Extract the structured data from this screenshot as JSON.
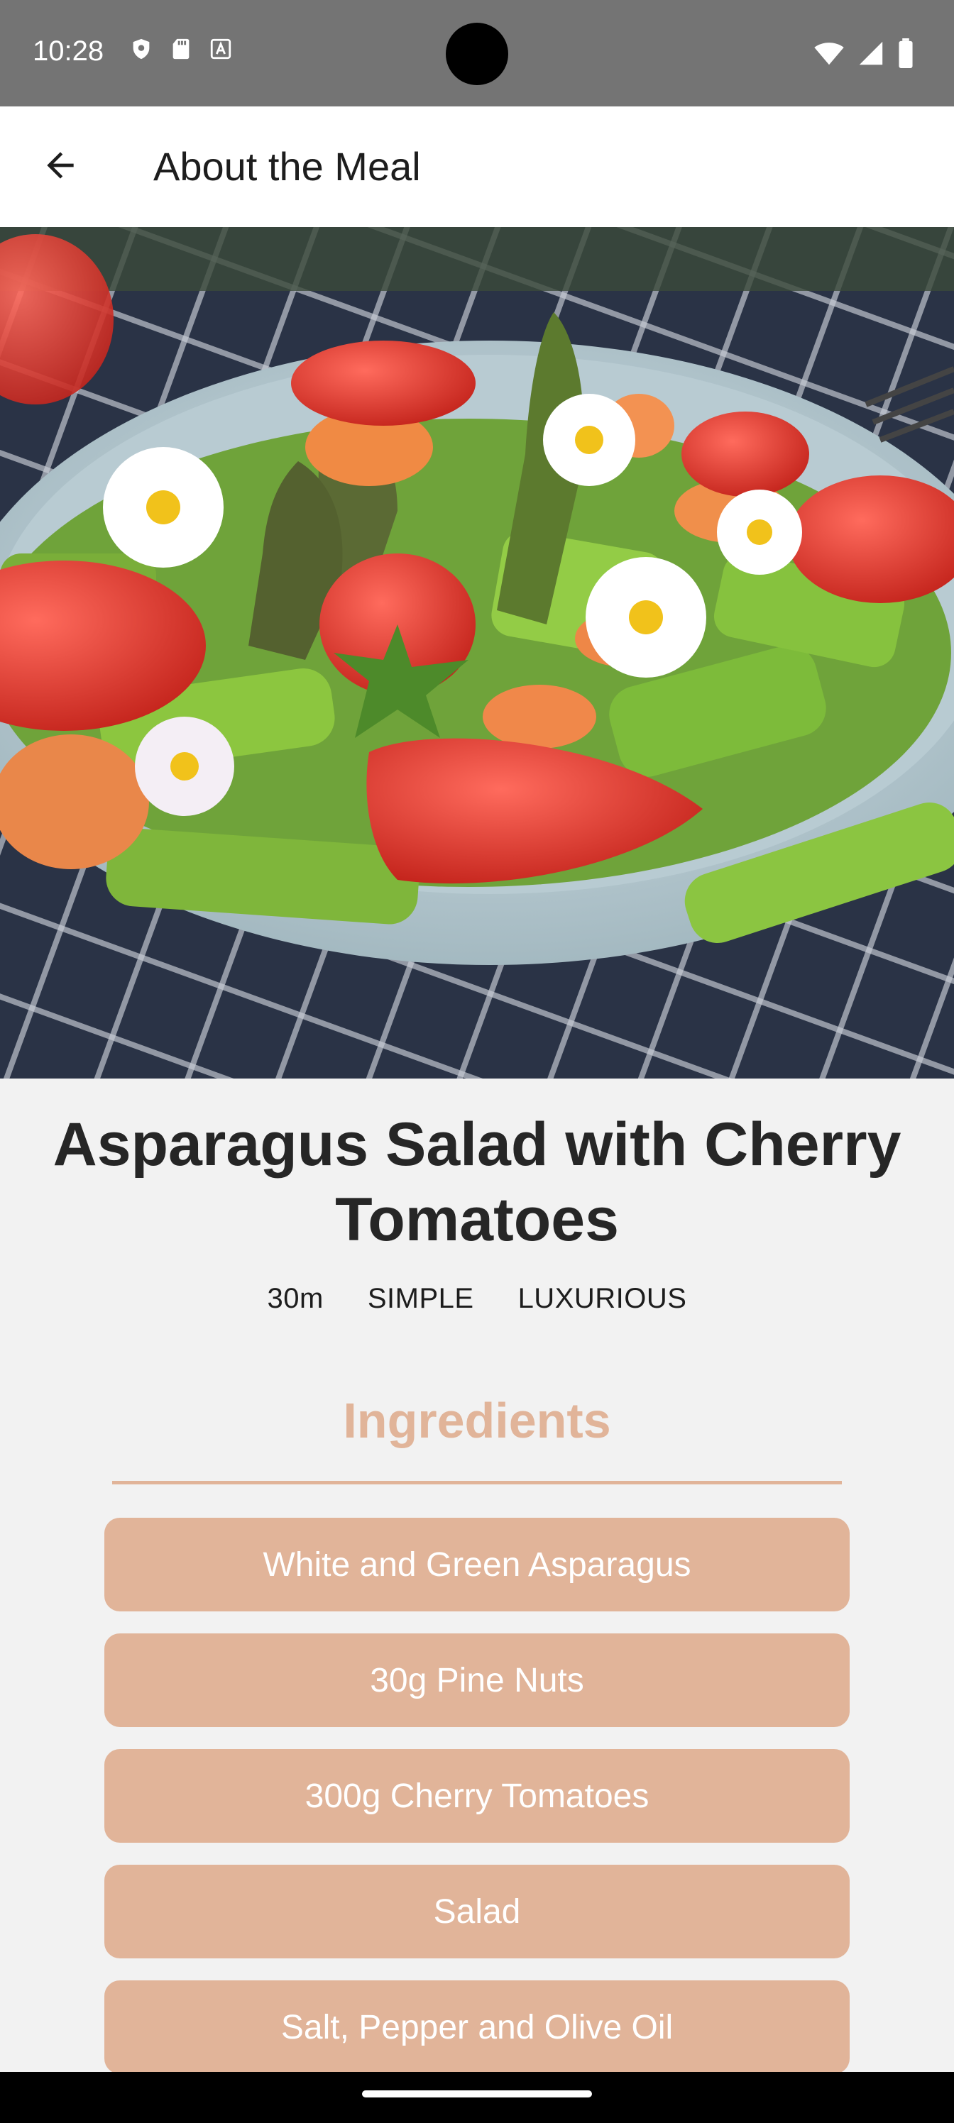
{
  "status_bar": {
    "time": "10:28",
    "left_icons": [
      "shield-icon",
      "sd-card-icon",
      "text-a-icon"
    ],
    "right_icons": [
      "wifi-icon",
      "cellular-signal-icon",
      "battery-icon"
    ]
  },
  "app_bar": {
    "title": "About the Meal",
    "back_icon": "arrow-back-icon"
  },
  "hero_image": {
    "alt": "Asparagus salad with strawberries and daisies in a bowl"
  },
  "meal": {
    "title": "Asparagus Salad with Cherry Tomatoes",
    "duration": "30m",
    "complexity": "SIMPLE",
    "affordability": "LUXURIOUS"
  },
  "ingredients": {
    "heading": "Ingredients",
    "items": [
      "White and Green Asparagus",
      "30g Pine Nuts",
      "300g Cherry Tomatoes",
      "Salad",
      "Salt, Pepper and Olive Oil"
    ]
  },
  "colors": {
    "accent": "#e1b499",
    "status_bar": "#747474",
    "background": "#f2f2f2"
  }
}
